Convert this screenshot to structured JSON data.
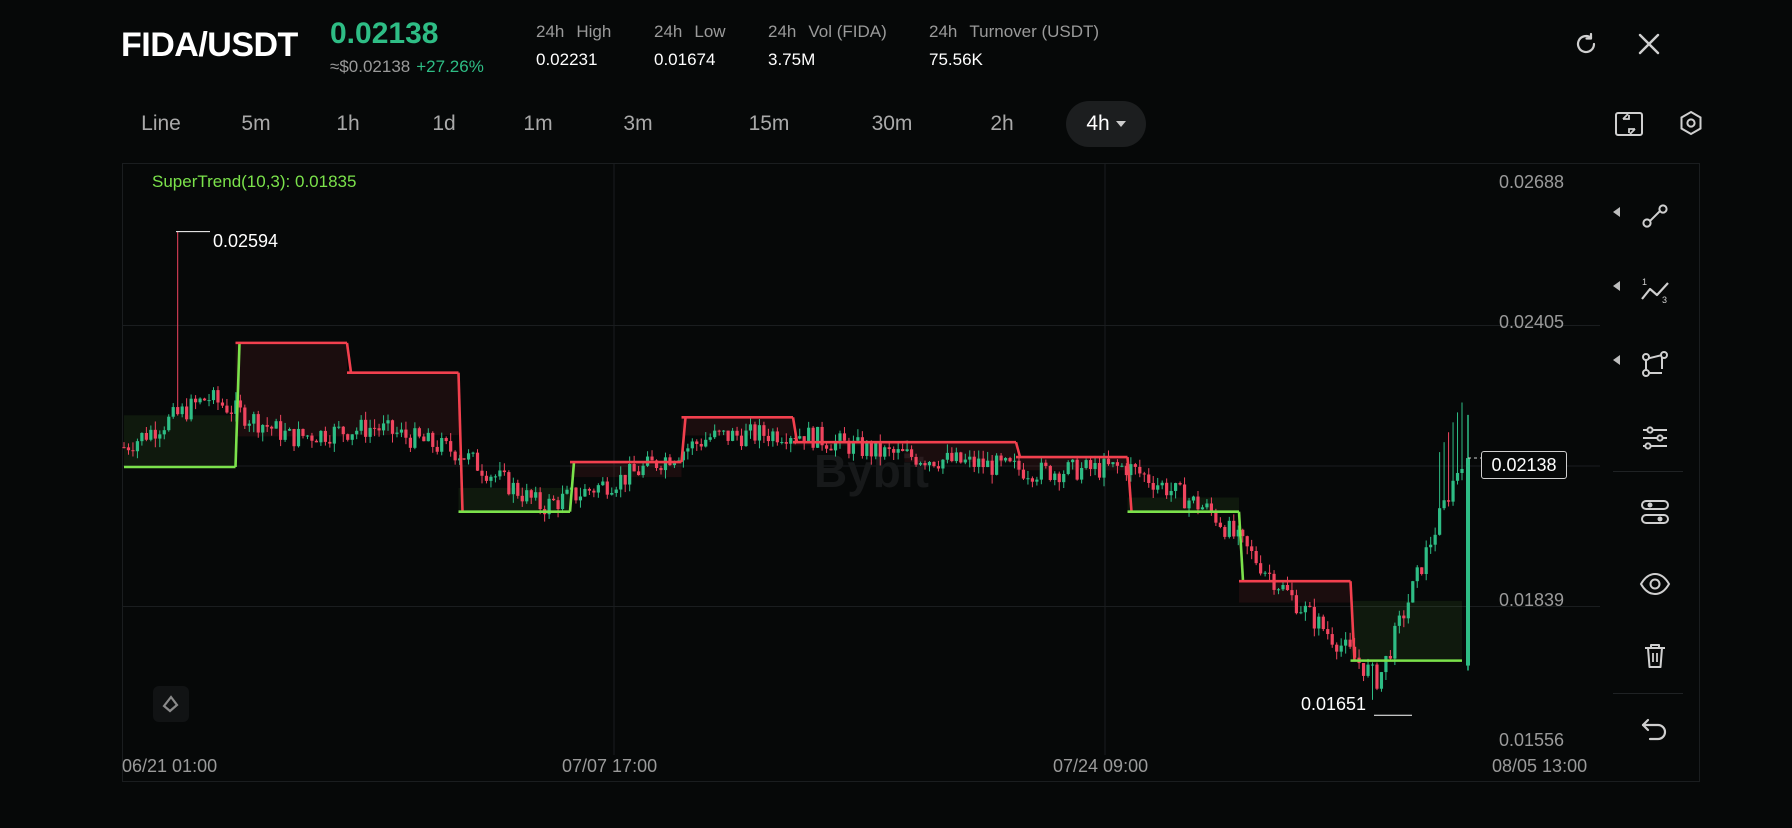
{
  "header": {
    "pair": "FIDA/USDT",
    "price": "0.02138",
    "approx": "≈$0.02138",
    "change": "+27.26%",
    "stats": [
      {
        "period": "24h",
        "label": "High",
        "value": "0.02231"
      },
      {
        "period": "24h",
        "label": "Low",
        "value": "0.01674"
      },
      {
        "period": "24h",
        "label": "Vol (FIDA)",
        "value": "3.75M"
      },
      {
        "period": "24h",
        "label": "Turnover (USDT)",
        "value": "75.56K"
      }
    ]
  },
  "icons": {
    "refresh": "refresh-icon",
    "close": "close-icon",
    "fullscreen": "fullscreen-toggle-icon",
    "settings": "settings-hexagon-icon",
    "tools": [
      "line-tool-icon",
      "trend-count-tool-icon",
      "shape-tool-icon",
      "adjust-sliders-icon",
      "indicator-settings-icon",
      "eye-icon",
      "trash-icon",
      "undo-icon"
    ]
  },
  "timeframes": {
    "items": [
      "Line",
      "5m",
      "1h",
      "1d",
      "1m",
      "3m",
      "15m",
      "30m",
      "2h",
      "4h"
    ],
    "active": "4h"
  },
  "colors": {
    "up": "#2ebd85",
    "down": "#f0455f",
    "supertrend_up": "#7be24b",
    "supertrend_down": "#f2404e",
    "background": "#060808"
  },
  "chart_data": {
    "type": "candlestick",
    "indicator_label": "SuperTrend(10,3): 0.01835",
    "y_ticks": [
      "0.02688",
      "0.02405",
      "0.01839",
      "0.01556"
    ],
    "x_ticks": [
      "06/21 01:00",
      "07/07 17:00",
      "07/24 09:00",
      "08/05 13:00"
    ],
    "ylim": [
      0.01556,
      0.02688
    ],
    "annotations": {
      "high": "0.02594",
      "low": "0.01651"
    },
    "last_price": "0.02138",
    "trend": [
      [
        "06/21",
        0.0216
      ],
      [
        "06/24",
        0.0226
      ],
      [
        "06/27",
        0.0218
      ],
      [
        "06/30",
        0.022
      ],
      [
        "07/03",
        0.0215
      ],
      [
        "07/05",
        0.0204
      ],
      [
        "07/07",
        0.021
      ],
      [
        "07/10",
        0.0218
      ],
      [
        "07/13",
        0.0219
      ],
      [
        "07/16",
        0.0215
      ],
      [
        "07/19",
        0.0213
      ],
      [
        "07/22",
        0.0211
      ],
      [
        "07/25",
        0.0212
      ],
      [
        "07/28",
        0.0203
      ],
      [
        "07/31",
        0.0185
      ],
      [
        "08/03",
        0.0169
      ],
      [
        "08/05",
        0.02138
      ]
    ],
    "supertrend": [
      0.0212,
      0.0237,
      0.0231,
      0.0203,
      0.0213,
      0.0222,
      0.0217,
      0.0217,
      0.0214,
      0.0203,
      0.0189,
      0.0173
    ]
  }
}
